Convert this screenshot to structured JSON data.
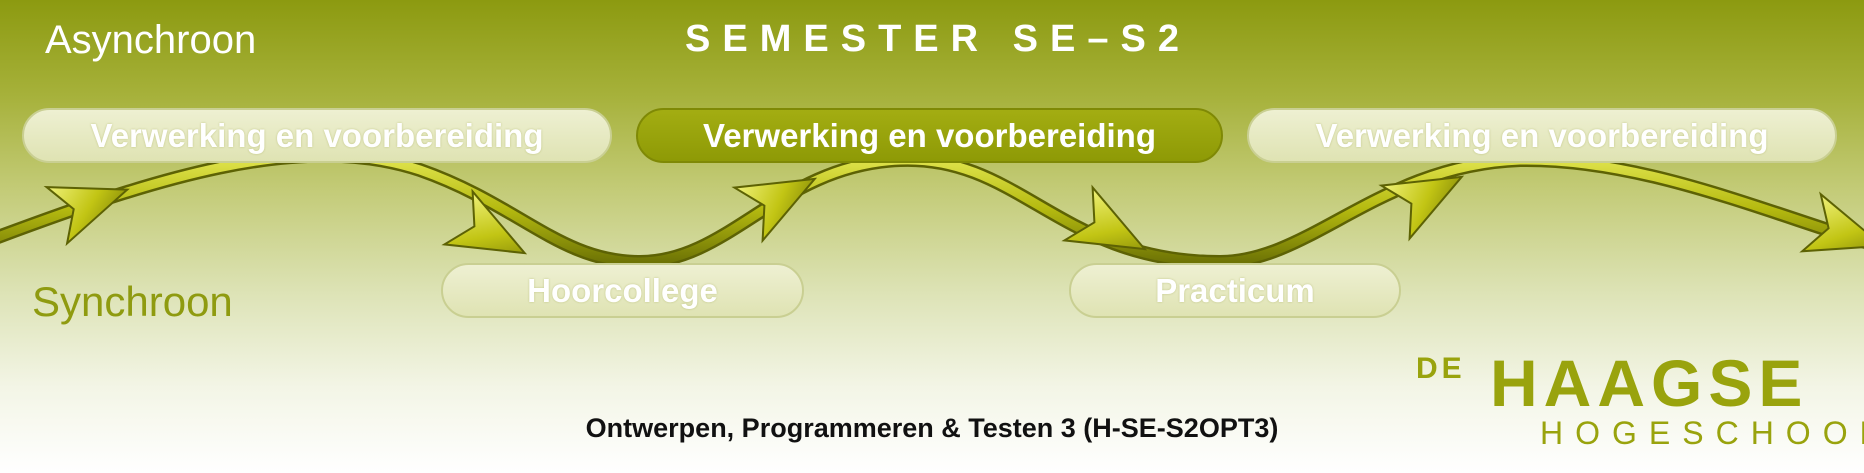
{
  "labels": {
    "asynchronous": "Asynchroon",
    "synchronous": "Synchroon"
  },
  "title": "SEMESTER SE–S2",
  "async_blocks": [
    {
      "label": "Verwerking en voorbereiding",
      "highlighted": false
    },
    {
      "label": "Verwerking en voorbereiding",
      "highlighted": true
    },
    {
      "label": "Verwerking en voorbereiding",
      "highlighted": false
    }
  ],
  "sync_blocks": [
    {
      "label": "Hoorcollege"
    },
    {
      "label": "Practicum"
    }
  ],
  "footer": "Ontwerpen, Programmeren & Testen 3 (H-SE-S2OPT3)",
  "logo": {
    "line1": "DE",
    "line2": "HAAGSE",
    "line3": "HOGESCHOOL"
  },
  "colors": {
    "accent": "#8f9b10",
    "highlight_block": "#99a30d",
    "wave": "#b9be12"
  }
}
